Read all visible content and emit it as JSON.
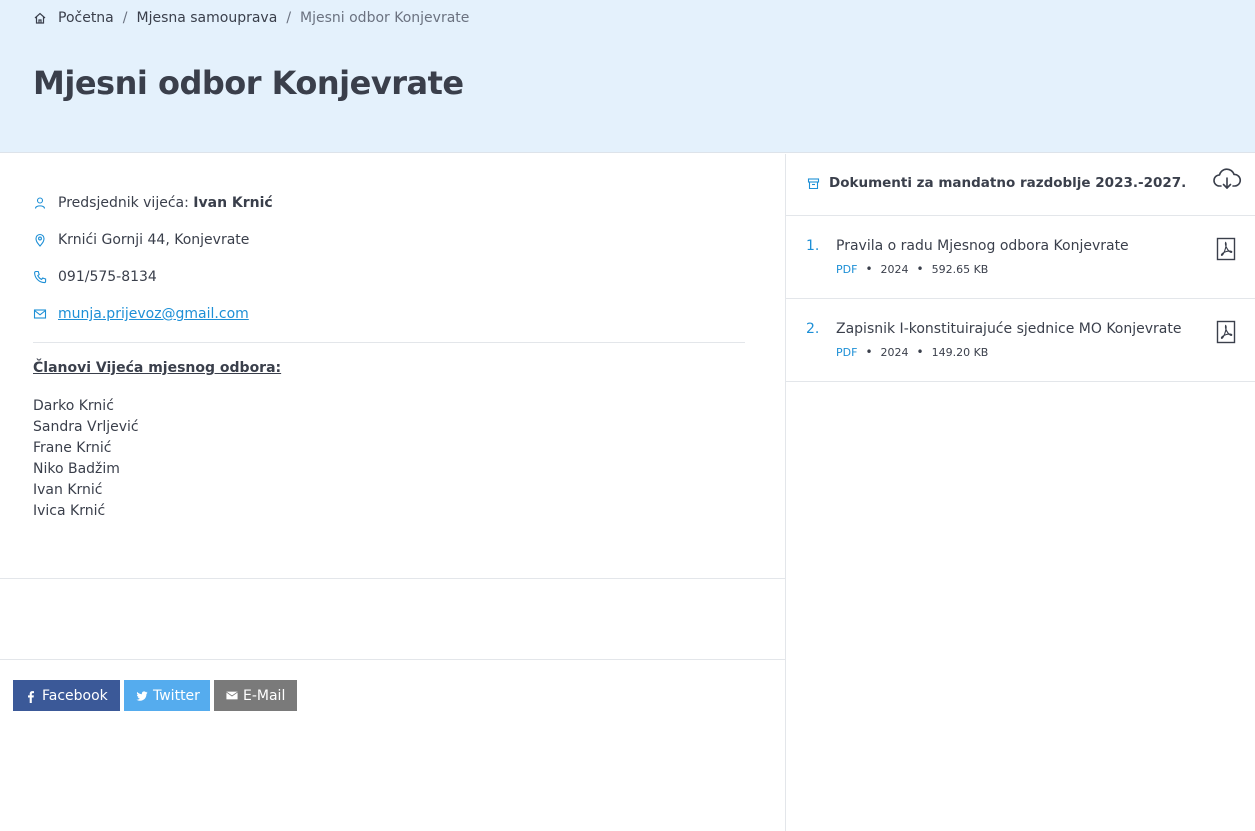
{
  "breadcrumb": {
    "home": "Početna",
    "section": "Mjesna samouprava",
    "current": "Mjesni odbor Konjevrate",
    "separator": "/"
  },
  "page_title": "Mjesni odbor Konjevrate",
  "info": {
    "president_label": "Predsjednik vijeća:",
    "president_name": "Ivan Krnić",
    "address": "Krnići Gornji 44, Konjevrate",
    "phone": "091/575-8134",
    "email": "munja.prijevoz@gmail.com"
  },
  "members": {
    "title": "Članovi Vijeća mjesnog odbora:",
    "list": [
      "Darko Krnić",
      "Sandra Vrljević",
      "Frane Krnić",
      "Niko Badžim",
      "Ivan Krnić",
      "Ivica Krnić"
    ]
  },
  "share": {
    "facebook": "Facebook",
    "twitter": "Twitter",
    "email": "E-Mail"
  },
  "documents": {
    "title": "Dokumenti za mandatno razdoblje 2023.-2027.",
    "items": [
      {
        "number": "1.",
        "title": "Pravila o radu Mjesnog odbora Konjevrate",
        "type": "PDF",
        "year": "2024",
        "size": "592.65 KB"
      },
      {
        "number": "2.",
        "title": "Zapisnik I-konstituirajuće sjednice MO Konjevrate",
        "type": "PDF",
        "year": "2024",
        "size": "149.20 KB"
      }
    ]
  },
  "colors": {
    "hero_bg": "#e4f1fc",
    "accent": "#1d8fd6",
    "text": "#3a3f4b",
    "facebook": "#3b5998",
    "twitter": "#55acee",
    "email": "#7a7a7a"
  },
  "icons": {
    "home": "home-icon",
    "user": "user-icon",
    "location": "map-pin-icon",
    "phone": "phone-icon",
    "mail": "mail-icon",
    "archive": "archive-box-icon",
    "download": "cloud-download-icon",
    "pdf": "pdf-file-icon"
  }
}
